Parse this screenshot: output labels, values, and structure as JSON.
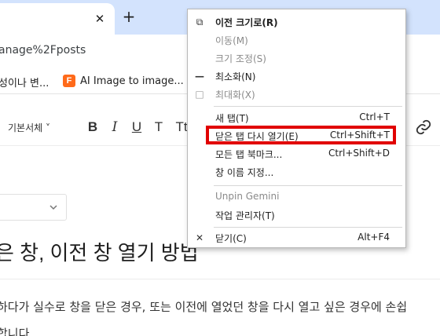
{
  "browser": {
    "tab_close_glyph": "✕",
    "new_tab_glyph": "+",
    "url_fragment": "anage%2Fposts",
    "bookmarks": [
      {
        "label": "성이나 변..."
      },
      {
        "label": "AI Image to image...",
        "favicon_letter": "F",
        "favicon_color": "#ff6a1a"
      }
    ]
  },
  "editor": {
    "font_select": "기본서체 ˅",
    "format_buttons": {
      "bold": "B",
      "italic": "I",
      "underline": "U",
      "strike": "T",
      "size": "Tt"
    },
    "post_title": "은 창, 이전 창 열기 방법",
    "body_text": "하다가 실수로 창을 닫은 경우, 또는 이전에 열었던 창을 다시 열고 싶은 경우에 손쉽",
    "body_text_2": "합니다"
  },
  "context_menu": {
    "items": [
      {
        "icon": "⧉",
        "label": "이전 크기로(R)",
        "shortcut": "",
        "disabled": false,
        "bold": true
      },
      {
        "icon": "",
        "label": "이동(M)",
        "shortcut": "",
        "disabled": true
      },
      {
        "icon": "",
        "label": "크기 조정(S)",
        "shortcut": "",
        "disabled": true
      },
      {
        "icon": "—",
        "label": "최소화(N)",
        "shortcut": "",
        "disabled": false
      },
      {
        "icon": "□",
        "label": "최대화(X)",
        "shortcut": "",
        "disabled": true
      },
      {
        "icon": "",
        "label": "새 탭(T)",
        "shortcut": "Ctrl+T",
        "disabled": false
      },
      {
        "icon": "",
        "label": "닫은 탭 다시 열기(E)",
        "shortcut": "Ctrl+Shift+T",
        "disabled": false
      },
      {
        "icon": "",
        "label": "모든 탭 북마크...",
        "shortcut": "Ctrl+Shift+D",
        "disabled": false
      },
      {
        "icon": "",
        "label": "창 이름 지정...",
        "shortcut": "",
        "disabled": false
      },
      {
        "icon": "",
        "label": "Unpin Gemini",
        "shortcut": "",
        "disabled": true
      },
      {
        "icon": "",
        "label": "작업 관리자(T)",
        "shortcut": "",
        "disabled": false
      },
      {
        "icon": "✕",
        "label": "닫기(C)",
        "shortcut": "Alt+F4",
        "disabled": false
      }
    ]
  },
  "colors": {
    "tabstrip_bg": "#d3e3fd",
    "highlight_border": "#e10000"
  }
}
